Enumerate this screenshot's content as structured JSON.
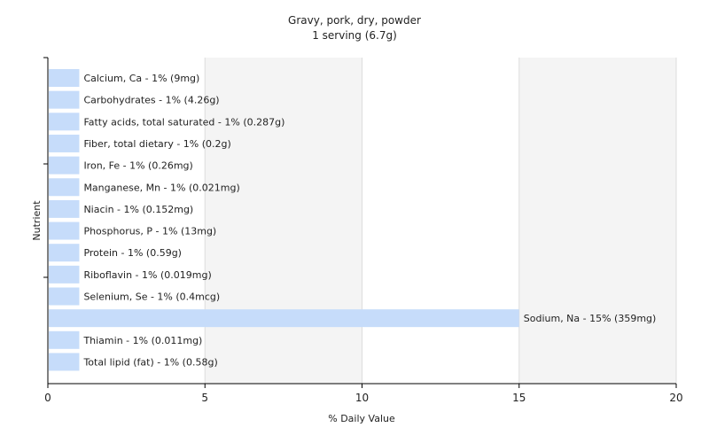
{
  "chart_data": {
    "type": "bar",
    "orientation": "horizontal",
    "title": "Gravy, pork, dry, powder",
    "subtitle": "1 serving (6.7g)",
    "xlabel": "% Daily Value",
    "ylabel": "Nutrient",
    "xlim": [
      0,
      20
    ],
    "xticks": [
      0,
      5,
      10,
      15,
      20
    ],
    "grid": true,
    "colors": {
      "bar": "#c6dcfa",
      "grid": "#dddddd",
      "axis": "#000000",
      "plot_band_light": "#ffffff",
      "plot_band_dark": "#f4f4f4"
    },
    "categories": [
      "Calcium, Ca",
      "Carbohydrates",
      "Fatty acids, total saturated",
      "Fiber, total dietary",
      "Iron, Fe",
      "Manganese, Mn",
      "Niacin",
      "Phosphorus, P",
      "Protein",
      "Riboflavin",
      "Selenium, Se",
      "Sodium, Na",
      "Thiamin",
      "Total lipid (fat)"
    ],
    "values": [
      1,
      1,
      1,
      1,
      1,
      1,
      1,
      1,
      1,
      1,
      1,
      15,
      1,
      1
    ],
    "data_labels": [
      "Calcium, Ca - 1% (9mg)",
      "Carbohydrates - 1% (4.26g)",
      "Fatty acids, total saturated - 1% (0.287g)",
      "Fiber, total dietary - 1% (0.2g)",
      "Iron, Fe - 1% (0.26mg)",
      "Manganese, Mn - 1% (0.021mg)",
      "Niacin - 1% (0.152mg)",
      "Phosphorus, P - 1% (13mg)",
      "Protein - 1% (0.59g)",
      "Riboflavin - 1% (0.019mg)",
      "Selenium, Se - 1% (0.4mcg)",
      "Sodium, Na - 15% (359mg)",
      "Thiamin - 1% (0.011mg)",
      "Total lipid (fat) - 1% (0.58g)"
    ]
  }
}
